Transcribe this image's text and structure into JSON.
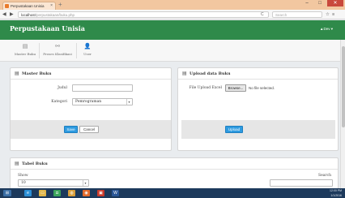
{
  "browser": {
    "tab_title": "Perpustakaan Unisia",
    "tab_close": "×",
    "new_tab": "+",
    "url_host": "localhost",
    "url_path": "/perpustakaan/buku.php",
    "reload": "C",
    "search_placeholder": "Search",
    "back": "◀",
    "forward": "▶",
    "win_min": "–",
    "win_max": "□",
    "win_close": "✕",
    "toolbar_icons": [
      "☆",
      "▣",
      "⛉",
      "⬇",
      "⌂",
      "≡"
    ]
  },
  "header": {
    "title": "Perpustakaan Unisia",
    "user_menu": "▲Dev ▾"
  },
  "menu": {
    "items": [
      {
        "label": "Master Buku",
        "icon": "book-icon",
        "glyph": "▤"
      },
      {
        "label": "Proses Klasifikasi",
        "icon": "sitemap-icon",
        "glyph": "⚯"
      },
      {
        "label": "User",
        "icon": "user-icon",
        "glyph": "👤"
      }
    ]
  },
  "master_buku": {
    "title": "Master Buku",
    "icon": "book-icon",
    "label_judul": "Judul",
    "judul_value": "",
    "label_kategori": "Kategori",
    "kategori_selected": "Pemrograman",
    "save_label": "Save",
    "cancel_label": "Cancel"
  },
  "upload": {
    "title": "Upload data Buku",
    "icon": "book-icon",
    "label_file": "File Upload Excel",
    "browse_label": "Browse...",
    "no_file": "No file selected.",
    "upload_label": "Upload"
  },
  "tabel": {
    "title": "Tabel Buku",
    "icon": "book-icon",
    "show_label": "Show",
    "show_value": "10",
    "search_label": "Search"
  },
  "taskbar": {
    "clock": "12:00 PM",
    "date": "1/1/2016"
  },
  "colors": {
    "header": "#2f8a4a",
    "primary_button": "#2e9be0",
    "taskbar": "#1d3a5c"
  }
}
